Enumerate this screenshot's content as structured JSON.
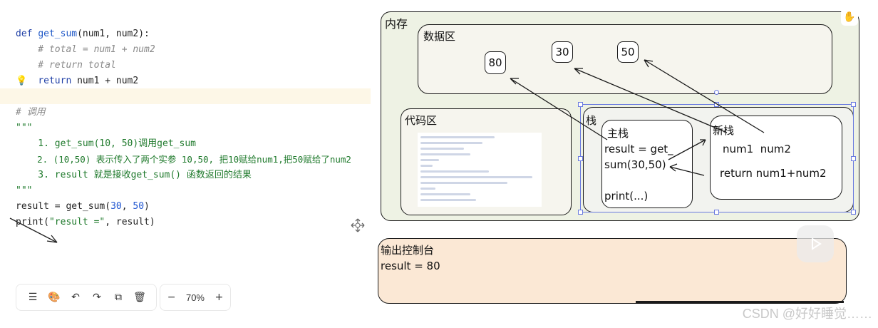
{
  "code": {
    "lines": [
      "def get_sum(num1, num2):",
      "    # total = num1 + num2",
      "    # return total",
      "    return num1 + num2",
      "",
      "# 调用",
      "\"\"\"",
      "    1. get_sum(10, 50)调用get_sum",
      "    2. (10,50) 表示传入了两个实参 10,50, 把10赋给num1,把50赋给了num2",
      "    3. result 就是接收get_sum() 函数返回的结果",
      "\"\"\"",
      "result = get_sum(30, 50)",
      "print(\"result =\", result)"
    ]
  },
  "toolbar": {
    "zoom": "70%"
  },
  "diagram": {
    "memory_label": "内存",
    "data_area_label": "数据区",
    "data_values": [
      "80",
      "30",
      "50"
    ],
    "code_area_label": "代码区",
    "stack_label": "栈",
    "main_stack_label": "主栈",
    "main_stack_code": [
      "result = get_",
      "sum(30,50)",
      "print(...)"
    ],
    "new_stack_label": "新栈",
    "new_stack_code": [
      "num1  num2",
      "return num1+num2"
    ],
    "console_label": "输出控制台",
    "console_output": "result = 80"
  },
  "watermark": "CSDN @好好睡觉……",
  "colors": {
    "memory_bg": "#eef2e4",
    "console_bg": "#fbe8d5",
    "selection": "#6a7ae0"
  }
}
